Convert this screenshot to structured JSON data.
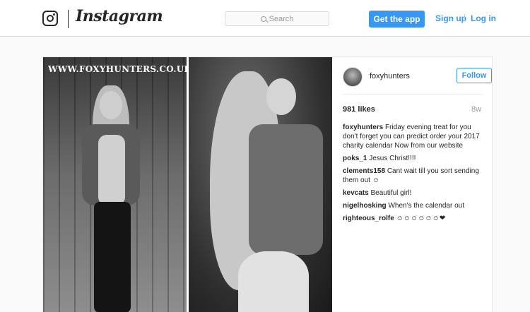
{
  "nav": {
    "wordmark": "Instagram",
    "search_placeholder": "Search",
    "get_app": "Get the app",
    "sign_up": "Sign up",
    "log_in": "Log in",
    "accent_color": "#3897f0"
  },
  "post": {
    "watermark": "WWW.FOXYHUNTERS.CO.UK",
    "username": "foxyhunters",
    "follow_label": "Follow",
    "likes": "981 likes",
    "age": "8w",
    "comments": [
      {
        "author": "foxyhunters",
        "text": "Friday evening treat for you don't forget you can predict order your 2017 charity calendar Now from our website"
      },
      {
        "author": "poks_1",
        "text": "Jesus Christ!!!!"
      },
      {
        "author": "clements158",
        "text": "Cant wait till you sort sending them out ☺"
      },
      {
        "author": "kevcats",
        "text": "Beautiful girl!"
      },
      {
        "author": "nigelhosking",
        "text": "When's the calendar out"
      },
      {
        "author": "righteous_rolfe",
        "text": "☺☺☺☺☺☺❤"
      }
    ]
  }
}
